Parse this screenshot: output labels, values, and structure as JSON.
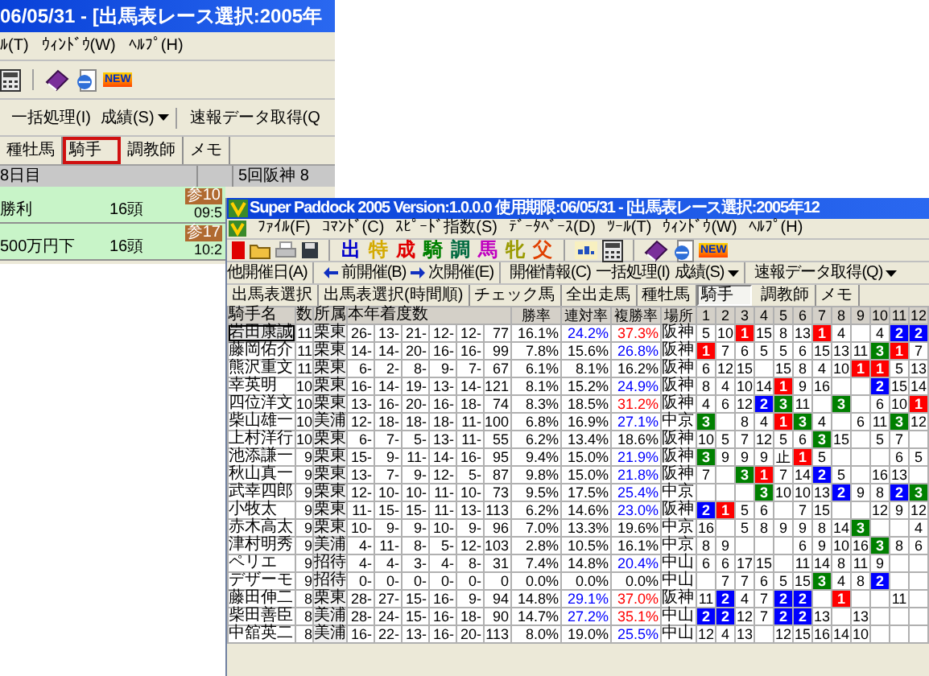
{
  "back_window": {
    "title": "06/05/31 - [出馬表レース選択:2005年",
    "menu": [
      "ﾙ(T)",
      "ｳｨﾝﾄﾞｳ(W)",
      "ﾍﾙﾌﾟ(H)"
    ],
    "new_badge": "NEW",
    "command_groups": [
      [
        {
          "label": "一括処理(I)",
          "dropdown": false
        },
        {
          "label": "成績(S)",
          "dropdown": true
        }
      ],
      [
        {
          "label": "速報データ取得(Q",
          "dropdown": false
        }
      ]
    ],
    "tabs": [
      {
        "label": "種牡馬",
        "selected": false
      },
      {
        "label": "騎手",
        "selected": true
      },
      {
        "label": "調教師",
        "selected": false
      },
      {
        "label": "メモ",
        "selected": false
      }
    ],
    "day_header": {
      "column_1": "8日目",
      "column_2": "5回阪神 8"
    },
    "races": [
      {
        "name": "勝利",
        "runners": "16頭",
        "badge": "参10",
        "time": "09:5"
      },
      {
        "name": "500万円下",
        "runners": "16頭",
        "badge": "参17",
        "time": "10:2"
      }
    ]
  },
  "front_window": {
    "title": "Super Paddock 2005 Version:1.0.0.0 使用期限:06/05/31 - [出馬表レース選択:2005年12",
    "menu": [
      "ﾌｧｲﾙ(F)",
      "ｺﾏﾝﾄﾞ(C)",
      "ｽﾋﾟｰﾄﾞ指数(S)",
      "ﾃﾞｰﾀﾍﾞｰｽ(D)",
      "ﾂｰﾙ(T)",
      "ｳｨﾝﾄﾞｳ(W)",
      "ﾍﾙﾌﾟ(H)"
    ],
    "letter_buttons": [
      {
        "text": "出",
        "color": "#0000cc"
      },
      {
        "text": "特",
        "color": "#d4aa00"
      },
      {
        "text": "成",
        "color": "#e00000"
      },
      {
        "text": "騎",
        "color": "#008000"
      },
      {
        "text": "調",
        "color": "#006a40"
      },
      {
        "text": "馬",
        "color": "#c000c0"
      },
      {
        "text": "牝",
        "color": "#9a9a00"
      },
      {
        "text": "父",
        "color": "#e04000"
      }
    ],
    "new_badge": "NEW",
    "command_groups": [
      [
        {
          "label": "他開催日(A)",
          "kind": "plain",
          "dropdown": false
        }
      ],
      [
        {
          "label": "前開催(B)",
          "kind": "back",
          "dropdown": false
        },
        {
          "label": "次開催(E)",
          "kind": "forward",
          "dropdown": false
        }
      ],
      [
        {
          "label": "開催情報(C)",
          "kind": "plain",
          "dropdown": false
        },
        {
          "label": "一括処理(I)",
          "kind": "plain",
          "dropdown": false
        },
        {
          "label": "成績(S)",
          "kind": "plain",
          "dropdown": true
        }
      ],
      [
        {
          "label": "速報データ取得(Q)",
          "kind": "plain",
          "dropdown": true
        }
      ]
    ],
    "tabs": [
      {
        "label": "出馬表選択",
        "selected": false
      },
      {
        "label": "出馬表選択(時間順)",
        "selected": false
      },
      {
        "label": "チェック馬",
        "selected": false
      },
      {
        "label": "全出走馬",
        "selected": false
      },
      {
        "label": "種牡馬",
        "selected": false
      },
      {
        "label": "騎手",
        "selected": true
      },
      {
        "label": "調教師",
        "selected": false
      },
      {
        "label": "メモ",
        "selected": false
      }
    ],
    "table": {
      "columns": [
        "騎手名",
        "数",
        "所属",
        "本年着度数",
        "",
        "",
        "",
        "",
        "",
        "勝率",
        "連対率",
        "複勝率",
        "場所",
        "1",
        "2",
        "3",
        "4",
        "5",
        "6",
        "7",
        "8",
        "9",
        "10",
        "11",
        "12"
      ],
      "rows": [
        {
          "selected": true,
          "name": "岩田康誠",
          "count": "11",
          "affiliation": "栗東",
          "results": [
            "26-",
            "13-",
            "21-",
            "12-",
            "12-",
            "77"
          ],
          "win": "16.1%",
          "place": {
            "text": "24.2%",
            "color": "#0000ff"
          },
          "show": {
            "text": "37.3%",
            "color": "#ff0000"
          },
          "venue": "阪神",
          "cells": [
            "5",
            "10",
            {
              "text": "1",
              "color": "#ff0000"
            },
            "15",
            "8",
            "13",
            {
              "text": "1",
              "color": "#ff0000"
            },
            "4",
            null,
            "4",
            {
              "text": "2",
              "color": "#0000ff"
            },
            {
              "text": "2",
              "color": "#0000ff"
            }
          ]
        },
        {
          "selected": false,
          "name": "藤岡佑介",
          "count": "11",
          "affiliation": "栗東",
          "results": [
            "14-",
            "14-",
            "20-",
            "16-",
            "16-",
            "99"
          ],
          "win": "7.8%",
          "place": {
            "text": "15.6%",
            "color": "#000000"
          },
          "show": {
            "text": "26.8%",
            "color": "#0000ff"
          },
          "venue": "阪神",
          "cells": [
            {
              "text": "1",
              "color": "#ff0000"
            },
            "7",
            "6",
            "5",
            "5",
            "6",
            "15",
            "13",
            "11",
            {
              "text": "3",
              "color": "#008000"
            },
            {
              "text": "1",
              "color": "#ff0000"
            },
            "7"
          ]
        },
        {
          "selected": false,
          "name": "熊沢重文",
          "count": "11",
          "affiliation": "栗東",
          "results": [
            "6-",
            "2-",
            "8-",
            "9-",
            "7-",
            "67"
          ],
          "win": "6.1%",
          "place": {
            "text": "8.1%",
            "color": "#000000"
          },
          "show": {
            "text": "16.2%",
            "color": "#000000"
          },
          "venue": "阪神",
          "cells": [
            "6",
            "12",
            "15",
            null,
            "15",
            "8",
            "4",
            "10",
            {
              "text": "1",
              "color": "#ff0000"
            },
            {
              "text": "1",
              "color": "#ff0000"
            },
            "5",
            "13"
          ]
        },
        {
          "selected": false,
          "name": "幸英明",
          "count": "10",
          "affiliation": "栗東",
          "results": [
            "16-",
            "14-",
            "19-",
            "13-",
            "14-",
            "121"
          ],
          "win": "8.1%",
          "place": {
            "text": "15.2%",
            "color": "#000000"
          },
          "show": {
            "text": "24.9%",
            "color": "#0000ff"
          },
          "venue": "阪神",
          "cells": [
            "8",
            "4",
            "10",
            "14",
            {
              "text": "1",
              "color": "#ff0000"
            },
            "9",
            "16",
            null,
            null,
            {
              "text": "2",
              "color": "#0000ff"
            },
            "15",
            "14"
          ]
        },
        {
          "selected": false,
          "name": "四位洋文",
          "count": "10",
          "affiliation": "栗東",
          "results": [
            "13-",
            "16-",
            "20-",
            "16-",
            "18-",
            "74"
          ],
          "win": "8.3%",
          "place": {
            "text": "18.5%",
            "color": "#000000"
          },
          "show": {
            "text": "31.2%",
            "color": "#ff0000"
          },
          "venue": "阪神",
          "cells": [
            "4",
            "6",
            "12",
            {
              "text": "2",
              "color": "#0000ff"
            },
            {
              "text": "3",
              "color": "#008000"
            },
            "11",
            null,
            {
              "text": "3",
              "color": "#008000"
            },
            null,
            "6",
            "10",
            {
              "text": "1",
              "color": "#ff0000"
            }
          ]
        },
        {
          "selected": false,
          "name": "柴山雄一",
          "count": "10",
          "affiliation": "美浦",
          "results": [
            "12-",
            "18-",
            "18-",
            "18-",
            "11-",
            "100"
          ],
          "win": "6.8%",
          "place": {
            "text": "16.9%",
            "color": "#000000"
          },
          "show": {
            "text": "27.1%",
            "color": "#0000ff"
          },
          "venue": "中京",
          "cells": [
            {
              "text": "3",
              "color": "#008000"
            },
            null,
            "8",
            "4",
            {
              "text": "1",
              "color": "#ff0000"
            },
            {
              "text": "3",
              "color": "#008000"
            },
            "4",
            null,
            "6",
            "11",
            {
              "text": "3",
              "color": "#008000"
            },
            "12"
          ]
        },
        {
          "selected": false,
          "name": "上村洋行",
          "count": "10",
          "affiliation": "栗東",
          "results": [
            "6-",
            "7-",
            "5-",
            "13-",
            "11-",
            "55"
          ],
          "win": "6.2%",
          "place": {
            "text": "13.4%",
            "color": "#000000"
          },
          "show": {
            "text": "18.6%",
            "color": "#000000"
          },
          "venue": "阪神",
          "cells": [
            "10",
            "5",
            "7",
            "12",
            "5",
            "6",
            {
              "text": "3",
              "color": "#008000"
            },
            "15",
            null,
            "5",
            "7",
            null
          ]
        },
        {
          "selected": false,
          "name": "池添謙一",
          "count": "9",
          "affiliation": "栗東",
          "results": [
            "15-",
            "9-",
            "11-",
            "14-",
            "16-",
            "95"
          ],
          "win": "9.4%",
          "place": {
            "text": "15.0%",
            "color": "#000000"
          },
          "show": {
            "text": "21.9%",
            "color": "#0000ff"
          },
          "venue": "阪神",
          "cells": [
            {
              "text": "3",
              "color": "#008000"
            },
            "9",
            "9",
            "9",
            "止",
            {
              "text": "1",
              "color": "#ff0000"
            },
            "5",
            null,
            null,
            null,
            "6",
            "5"
          ]
        },
        {
          "selected": false,
          "name": "秋山真一",
          "count": "9",
          "affiliation": "栗東",
          "results": [
            "13-",
            "7-",
            "9-",
            "12-",
            "5-",
            "87"
          ],
          "win": "9.8%",
          "place": {
            "text": "15.0%",
            "color": "#000000"
          },
          "show": {
            "text": "21.8%",
            "color": "#0000ff"
          },
          "venue": "阪神",
          "cells": [
            "7",
            null,
            {
              "text": "3",
              "color": "#008000"
            },
            {
              "text": "1",
              "color": "#ff0000"
            },
            "7",
            "14",
            {
              "text": "2",
              "color": "#0000ff"
            },
            "5",
            null,
            "16",
            "13",
            null
          ]
        },
        {
          "selected": false,
          "name": "武幸四郎",
          "count": "9",
          "affiliation": "栗東",
          "results": [
            "12-",
            "10-",
            "10-",
            "11-",
            "10-",
            "73"
          ],
          "win": "9.5%",
          "place": {
            "text": "17.5%",
            "color": "#000000"
          },
          "show": {
            "text": "25.4%",
            "color": "#0000ff"
          },
          "venue": "中京",
          "cells": [
            null,
            null,
            null,
            {
              "text": "3",
              "color": "#008000"
            },
            "10",
            "10",
            "13",
            {
              "text": "2",
              "color": "#0000ff"
            },
            "9",
            "8",
            {
              "text": "2",
              "color": "#0000ff"
            },
            {
              "text": "3",
              "color": "#008000"
            }
          ]
        },
        {
          "selected": false,
          "name": "小牧太",
          "count": "9",
          "affiliation": "栗東",
          "results": [
            "11-",
            "15-",
            "15-",
            "11-",
            "13-",
            "113"
          ],
          "win": "6.2%",
          "place": {
            "text": "14.6%",
            "color": "#000000"
          },
          "show": {
            "text": "23.0%",
            "color": "#0000ff"
          },
          "venue": "阪神",
          "cells": [
            {
              "text": "2",
              "color": "#0000ff"
            },
            {
              "text": "1",
              "color": "#ff0000"
            },
            "5",
            "6",
            null,
            "7",
            "15",
            null,
            null,
            "12",
            "9",
            "12"
          ]
        },
        {
          "selected": false,
          "name": "赤木高太",
          "count": "9",
          "affiliation": "栗東",
          "results": [
            "10-",
            "9-",
            "9-",
            "10-",
            "9-",
            "96"
          ],
          "win": "7.0%",
          "place": {
            "text": "13.3%",
            "color": "#000000"
          },
          "show": {
            "text": "19.6%",
            "color": "#000000"
          },
          "venue": "中京",
          "cells": [
            "16",
            null,
            "5",
            "8",
            "9",
            "9",
            "8",
            "14",
            {
              "text": "3",
              "color": "#008000"
            },
            null,
            null,
            "4"
          ]
        },
        {
          "selected": false,
          "name": "津村明秀",
          "count": "9",
          "affiliation": "美浦",
          "results": [
            "4-",
            "11-",
            "8-",
            "5-",
            "12-",
            "103"
          ],
          "win": "2.8%",
          "place": {
            "text": "10.5%",
            "color": "#000000"
          },
          "show": {
            "text": "16.1%",
            "color": "#000000"
          },
          "venue": "中京",
          "cells": [
            "8",
            "9",
            null,
            null,
            null,
            "6",
            "9",
            "10",
            "16",
            {
              "text": "3",
              "color": "#008000"
            },
            "8",
            "6"
          ]
        },
        {
          "selected": false,
          "name": "ペリエ",
          "count": "9",
          "affiliation": "招待",
          "results": [
            "4-",
            "4-",
            "3-",
            "4-",
            "8-",
            "31"
          ],
          "win": "7.4%",
          "place": {
            "text": "14.8%",
            "color": "#000000"
          },
          "show": {
            "text": "20.4%",
            "color": "#0000ff"
          },
          "venue": "中山",
          "cells": [
            "6",
            "6",
            "17",
            "15",
            null,
            "11",
            "14",
            "8",
            "11",
            "9",
            null,
            null
          ]
        },
        {
          "selected": false,
          "name": "デザーモ",
          "count": "9",
          "affiliation": "招待",
          "results": [
            "0-",
            "0-",
            "0-",
            "0-",
            "0-",
            "0"
          ],
          "win": "0.0%",
          "place": {
            "text": "0.0%",
            "color": "#000000"
          },
          "show": {
            "text": "0.0%",
            "color": "#000000"
          },
          "venue": "中山",
          "cells": [
            null,
            "7",
            "7",
            "6",
            "5",
            "15",
            {
              "text": "3",
              "color": "#008000"
            },
            "4",
            "8",
            {
              "text": "2",
              "color": "#0000ff"
            },
            null,
            null
          ]
        },
        {
          "selected": false,
          "name": "藤田伸二",
          "count": "8",
          "affiliation": "栗東",
          "results": [
            "28-",
            "27-",
            "15-",
            "16-",
            "9-",
            "94"
          ],
          "win": "14.8%",
          "place": {
            "text": "29.1%",
            "color": "#0000ff"
          },
          "show": {
            "text": "37.0%",
            "color": "#ff0000"
          },
          "venue": "阪神",
          "cells": [
            "11",
            {
              "text": "2",
              "color": "#0000ff"
            },
            "4",
            "7",
            {
              "text": "2",
              "color": "#0000ff"
            },
            {
              "text": "2",
              "color": "#0000ff"
            },
            null,
            {
              "text": "1",
              "color": "#ff0000"
            },
            null,
            null,
            "11",
            null
          ]
        },
        {
          "selected": false,
          "name": "柴田善臣",
          "count": "8",
          "affiliation": "美浦",
          "results": [
            "28-",
            "24-",
            "15-",
            "16-",
            "18-",
            "90"
          ],
          "win": "14.7%",
          "place": {
            "text": "27.2%",
            "color": "#0000ff"
          },
          "show": {
            "text": "35.1%",
            "color": "#ff0000"
          },
          "venue": "中山",
          "cells": [
            {
              "text": "2",
              "color": "#0000ff"
            },
            {
              "text": "2",
              "color": "#0000ff"
            },
            "12",
            "7",
            {
              "text": "2",
              "color": "#0000ff"
            },
            {
              "text": "2",
              "color": "#0000ff"
            },
            "13",
            null,
            "13",
            null,
            null,
            null
          ]
        },
        {
          "selected": false,
          "name": "中舘英二",
          "count": "8",
          "affiliation": "美浦",
          "results": [
            "16-",
            "22-",
            "13-",
            "16-",
            "20-",
            "113"
          ],
          "win": "8.0%",
          "place": {
            "text": "19.0%",
            "color": "#000000"
          },
          "show": {
            "text": "25.5%",
            "color": "#0000ff"
          },
          "venue": "中山",
          "cells": [
            "12",
            "4",
            "13",
            null,
            "12",
            "15",
            "16",
            "14",
            "10",
            null,
            null,
            null
          ]
        }
      ]
    }
  }
}
